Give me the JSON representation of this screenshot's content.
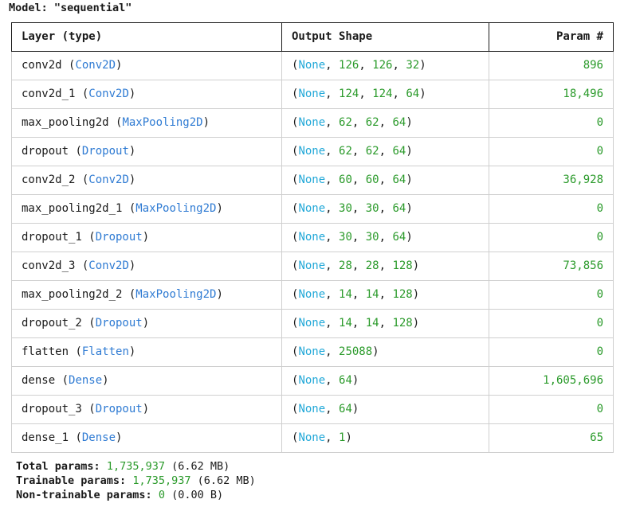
{
  "model_header": {
    "prefix": "Model: ",
    "name": "\"sequential\""
  },
  "columns": {
    "layer": "Layer (type)",
    "output_shape": "Output Shape",
    "param": "Param #"
  },
  "rows": [
    {
      "name": "conv2d",
      "type": "Conv2D",
      "shape": [
        "None",
        "126",
        "126",
        "32"
      ],
      "param": "896"
    },
    {
      "name": "conv2d_1",
      "type": "Conv2D",
      "shape": [
        "None",
        "124",
        "124",
        "64"
      ],
      "param": "18,496"
    },
    {
      "name": "max_pooling2d",
      "type": "MaxPooling2D",
      "shape": [
        "None",
        "62",
        "62",
        "64"
      ],
      "param": "0"
    },
    {
      "name": "dropout",
      "type": "Dropout",
      "shape": [
        "None",
        "62",
        "62",
        "64"
      ],
      "param": "0"
    },
    {
      "name": "conv2d_2",
      "type": "Conv2D",
      "shape": [
        "None",
        "60",
        "60",
        "64"
      ],
      "param": "36,928"
    },
    {
      "name": "max_pooling2d_1",
      "type": "MaxPooling2D",
      "shape": [
        "None",
        "30",
        "30",
        "64"
      ],
      "param": "0"
    },
    {
      "name": "dropout_1",
      "type": "Dropout",
      "shape": [
        "None",
        "30",
        "30",
        "64"
      ],
      "param": "0"
    },
    {
      "name": "conv2d_3",
      "type": "Conv2D",
      "shape": [
        "None",
        "28",
        "28",
        "128"
      ],
      "param": "73,856"
    },
    {
      "name": "max_pooling2d_2",
      "type": "MaxPooling2D",
      "shape": [
        "None",
        "14",
        "14",
        "128"
      ],
      "param": "0"
    },
    {
      "name": "dropout_2",
      "type": "Dropout",
      "shape": [
        "None",
        "14",
        "14",
        "128"
      ],
      "param": "0"
    },
    {
      "name": "flatten",
      "type": "Flatten",
      "shape": [
        "None",
        "25088"
      ],
      "param": "0"
    },
    {
      "name": "dense",
      "type": "Dense",
      "shape": [
        "None",
        "64"
      ],
      "param": "1,605,696"
    },
    {
      "name": "dropout_3",
      "type": "Dropout",
      "shape": [
        "None",
        "64"
      ],
      "param": "0"
    },
    {
      "name": "dense_1",
      "type": "Dense",
      "shape": [
        "None",
        "1"
      ],
      "param": "65"
    }
  ],
  "totals": {
    "total": {
      "label": "Total params:",
      "value": "1,735,937",
      "size": "(6.62 MB)"
    },
    "trainable": {
      "label": "Trainable params:",
      "value": "1,735,937",
      "size": "(6.62 MB)"
    },
    "non_trainable": {
      "label": "Non-trainable params:",
      "value": "0",
      "size": "(0.00 B)"
    }
  },
  "colors": {
    "layer_class": "#2f7bd3",
    "none_keyword": "#22a8d8",
    "number": "#2a9a2a"
  }
}
